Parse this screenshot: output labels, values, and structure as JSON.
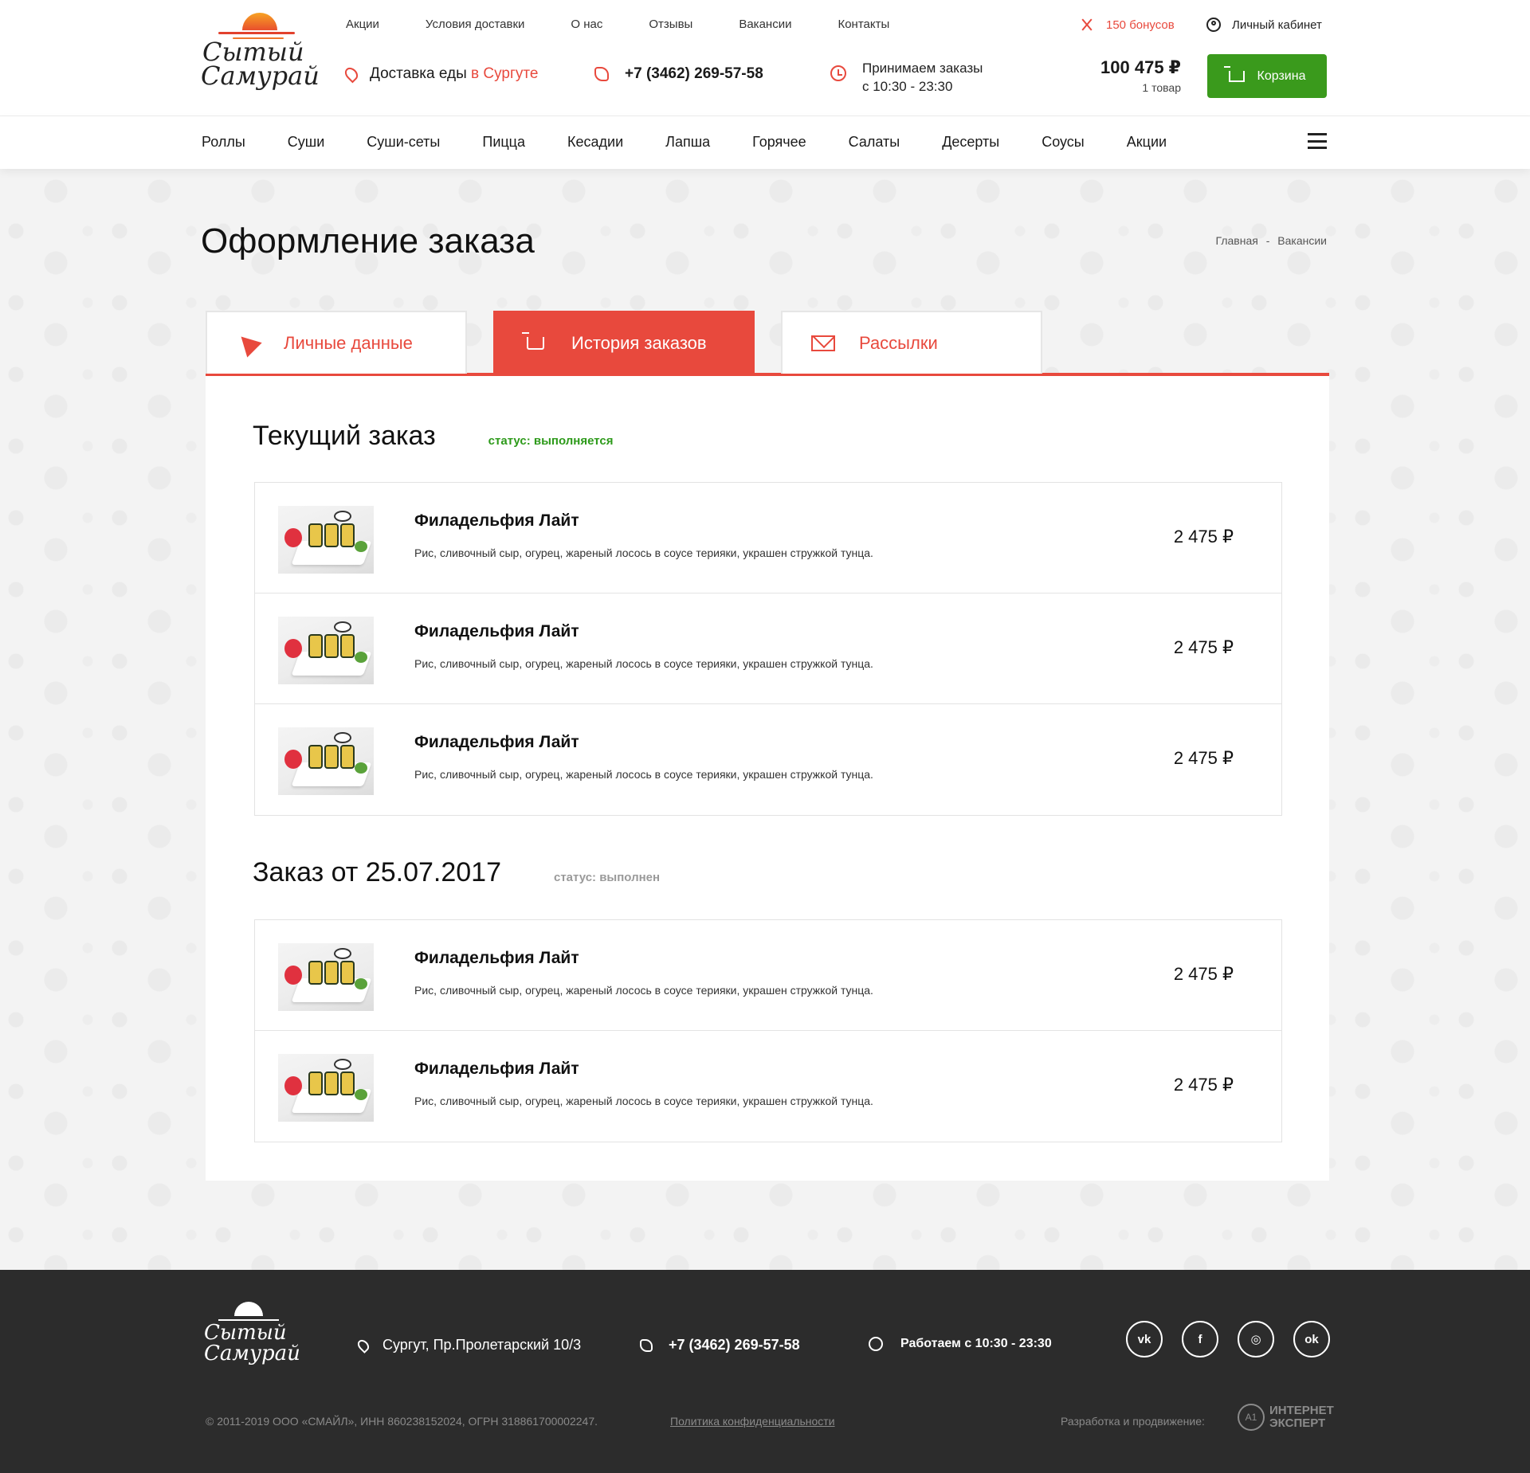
{
  "brand": {
    "logo_line1": "Сытый",
    "logo_line2": "Самурай"
  },
  "header": {
    "top_links": [
      "Акции",
      "Условия доставки",
      "О нас",
      "Отзывы",
      "Вакансии",
      "Контакты"
    ],
    "bonus": "150 бонусов",
    "cabinet": "Личный кабинет",
    "delivery_prefix": "Доставка еды",
    "delivery_city": "в Сургуте",
    "phone": "+7 (3462) 269-57-58",
    "hours_line1": "Принимаем заказы",
    "hours_line2": "с 10:30 - 23:30",
    "total_sum": "100 475 ₽",
    "total_count": "1 товар",
    "cart_label": "Корзина"
  },
  "categories": [
    "Роллы",
    "Суши",
    "Суши-сеты",
    "Пицца",
    "Кесадии",
    "Лапша",
    "Горячее",
    "Салаты",
    "Десерты",
    "Соусы",
    "Акции"
  ],
  "page": {
    "title": "Оформление заказа",
    "breadcrumb_home": "Главная",
    "breadcrumb_sep": "-",
    "breadcrumb_current": "Вакансии"
  },
  "tabs": [
    {
      "label": "Личные данные",
      "icon": "cursor-icon",
      "active": false
    },
    {
      "label": "История заказов",
      "icon": "cart-icon",
      "active": true
    },
    {
      "label": "Рассылки",
      "icon": "mail-icon",
      "active": false
    }
  ],
  "orders": [
    {
      "title": "Текущий заказ",
      "status": "статус: выполняется",
      "status_color": "#2d9a1a",
      "items": [
        {
          "name": "Филадельфия Лайт",
          "desc": "Рис, сливочный сыр, огурец, жареный лосось в соусе терияки, украшен стружкой тунца.",
          "price": "2 475 ₽"
        },
        {
          "name": "Филадельфия Лайт",
          "desc": "Рис, сливочный сыр, огурец, жареный лосось в соусе терияки, украшен стружкой тунца.",
          "price": "2 475 ₽"
        },
        {
          "name": "Филадельфия Лайт",
          "desc": "Рис, сливочный сыр, огурец, жареный лосось в соусе терияки, украшен стружкой тунца.",
          "price": "2 475 ₽"
        }
      ]
    },
    {
      "title": "Заказ от 25.07.2017",
      "status": "статус: выполнен",
      "status_color": "#9a9a9a",
      "items": [
        {
          "name": "Филадельфия Лайт",
          "desc": "Рис, сливочный сыр, огурец, жареный лосось в соусе терияки, украшен стружкой тунца.",
          "price": "2 475 ₽"
        },
        {
          "name": "Филадельфия Лайт",
          "desc": "Рис, сливочный сыр, огурец, жареный лосось в соусе терияки, украшен стружкой тунца.",
          "price": "2 475 ₽"
        }
      ]
    }
  ],
  "footer": {
    "address": "Сургут, Пр.Пролетарский 10/3",
    "phone": "+7 (3462) 269-57-58",
    "hours": "Работаем с 10:30 - 23:30",
    "socials": [
      {
        "name": "vk-icon",
        "glyph": "vk"
      },
      {
        "name": "facebook-icon",
        "glyph": "f"
      },
      {
        "name": "instagram-icon",
        "glyph": "◎"
      },
      {
        "name": "odnoklassniki-icon",
        "glyph": "ok"
      }
    ],
    "copyright": "© 2011-2019  ООО «СМАЙЛ», ИНН 860238152024, ОГРН 318861700002247.",
    "policy": "Политика конфиденциальности",
    "dev_label": "Разработка и продвижение:",
    "dev_logo_mark": "A1",
    "dev_logo_line1": "ИНТЕРНЕТ",
    "dev_logo_line2": "ЭКСПЕРТ"
  },
  "colors": {
    "accent": "#e8493d",
    "green": "#3a9a1c",
    "footer_bg": "#2c2c2c"
  }
}
